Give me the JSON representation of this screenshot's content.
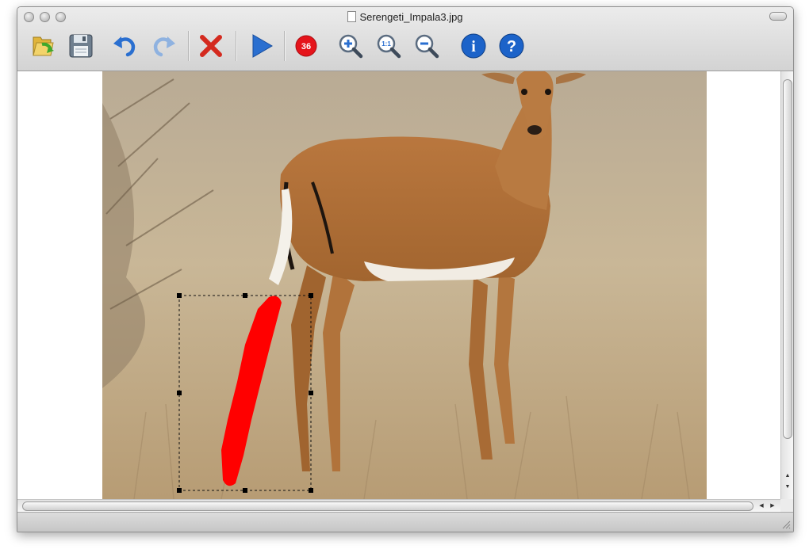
{
  "window": {
    "title": "Serengeti_Impala3.jpg"
  },
  "toolbar": {
    "buttons": [
      {
        "icon": "open-folder-icon",
        "label": "Open"
      },
      {
        "icon": "save-icon",
        "label": "Save"
      },
      {
        "icon": "undo-icon",
        "label": "Undo"
      },
      {
        "icon": "redo-icon",
        "label": "Redo"
      },
      {
        "icon": "delete-icon",
        "label": "Delete"
      },
      {
        "icon": "play-icon",
        "label": "Run"
      },
      {
        "icon": "badge-icon",
        "label": "36"
      },
      {
        "icon": "zoom-in-icon",
        "label": "Zoom In"
      },
      {
        "icon": "zoom-actual-icon",
        "label": "1:1"
      },
      {
        "icon": "zoom-out-icon",
        "label": "Zoom Out"
      },
      {
        "icon": "info-icon",
        "label": "i"
      },
      {
        "icon": "help-icon",
        "label": "?"
      }
    ]
  },
  "colors": {
    "accent_blue": "#1c63c9",
    "delete_red": "#d42a1f",
    "badge_red": "#e5141b",
    "mask_red": "#ff0000",
    "toolbar_bg": "#dcdcdc"
  }
}
